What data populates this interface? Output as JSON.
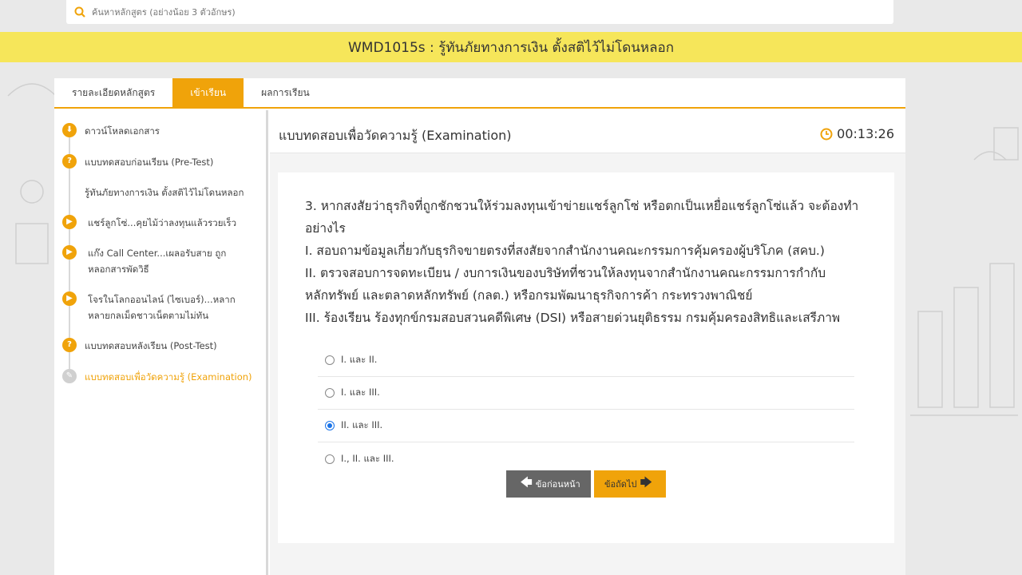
{
  "search": {
    "placeholder": "ค้นหาหลักสูตร (อย่างน้อย 3 ตัวอักษร)"
  },
  "course_title": "WMD1015s : รู้ทันภัยทางการเงิน ตั้งสติไว้ไม่โดนหลอก",
  "tabs": [
    {
      "label": "รายละเอียดหลักสูตร"
    },
    {
      "label": "เข้าเรียน"
    },
    {
      "label": "ผลการเรียน"
    }
  ],
  "sidebar": {
    "items": [
      {
        "label": "ดาวน์โหลดเอกสาร"
      },
      {
        "label": "แบบทดสอบก่อนเรียน (Pre-Test)"
      },
      {
        "label": "รู้ทันภัยทางการเงิน ตั้งสติไว้ไม่โดนหลอก"
      },
      {
        "label": "แชร์ลูกโซ่...คุยไม้ว่าลงทุนแล้วรวยเร็ว"
      },
      {
        "label_1": "แก๊ง Call Center...เผลอรับสาย ถูก",
        "label_2": "หลอกสารพัดวิธี"
      },
      {
        "label_1": "โจรในโลกออนไลน์ (ไซเบอร์)...หลาก",
        "label_2": "หลายกลเม็ดชาวเน็ตตามไม่ทัน"
      },
      {
        "label": "แบบทดสอบหลังเรียน (Post-Test)"
      },
      {
        "label": "แบบทดสอบเพื่อวัดความรู้ (Examination)"
      }
    ]
  },
  "exam": {
    "title": "แบบทดสอบเพื่อวัดความรู้ (Examination)",
    "timer": "00:13:26",
    "question_lines": [
      "3. หากสงสัยว่าธุรกิจที่ถูกชักชวนให้ร่วมลงทุนเข้าข่ายแชร์ลูกโซ่ หรือตกเป็นเหยื่อแชร์ลูกโซ่แล้ว จะต้องทำ",
      "อย่างไร",
      "I. สอบถามข้อมูลเกี่ยวกับธุรกิจขายตรงที่สงสัยจากสำนักงานคณะกรรมการคุ้มครองผู้บริโภค (สคบ.)",
      "II. ตรวจสอบการจดทะเบียน / งบการเงินของบริษัทที่ชวนให้ลงทุนจากสำนักงานคณะกรรมการกำกับ",
      "หลักทรัพย์ และตลาดหลักทรัพย์ (กลต.) หรือกรมพัฒนาธุรกิจการค้า กระทรวงพาณิชย์",
      "III. ร้องเรียน ร้องทุกข์กรมสอบสวนคดีพิเศษ (DSI) หรือสายด่วนยุติธรรม กรมคุ้มครองสิทธิและเสรีภาพ"
    ],
    "options": [
      {
        "label": "I. และ II.",
        "checked": false
      },
      {
        "label": "I. และ III.",
        "checked": false
      },
      {
        "label": "II. และ III.",
        "checked": true
      },
      {
        "label": "I., II. และ III.",
        "checked": false
      }
    ],
    "prev_label": "ข้อก่อนหน้า",
    "next_label": "ข้อถัดไป"
  }
}
